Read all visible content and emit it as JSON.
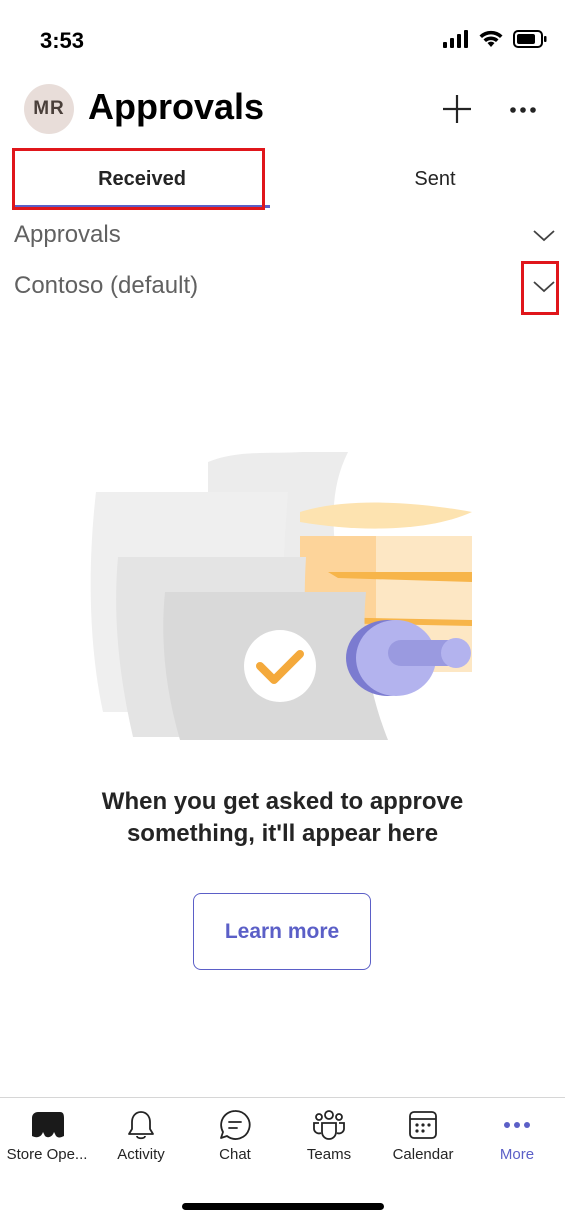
{
  "status_bar": {
    "time": "3:53"
  },
  "header": {
    "avatar_initials": "MR",
    "title": "Approvals"
  },
  "tabs": [
    {
      "label": "Received",
      "selected": true
    },
    {
      "label": "Sent",
      "selected": false
    }
  ],
  "filters": [
    {
      "label": "Approvals"
    },
    {
      "label": "Contoso (default)"
    }
  ],
  "empty_state": {
    "message_line1": "When you get asked to approve",
    "message_line2": "something, it'll appear here",
    "button_label": "Learn more"
  },
  "bottom_nav": {
    "items": [
      {
        "label": "Store Ope...",
        "icon": "store-icon"
      },
      {
        "label": "Activity",
        "icon": "bell-icon"
      },
      {
        "label": "Chat",
        "icon": "chat-icon"
      },
      {
        "label": "Teams",
        "icon": "teams-icon"
      },
      {
        "label": "Calendar",
        "icon": "calendar-icon"
      },
      {
        "label": "More",
        "icon": "more-icon",
        "active": true
      }
    ]
  },
  "colors": {
    "accent": "#5b5fc7",
    "highlight": "#e0161b",
    "illustration_check": "#f4a93b",
    "illustration_stamp": "#9a9ae0"
  }
}
